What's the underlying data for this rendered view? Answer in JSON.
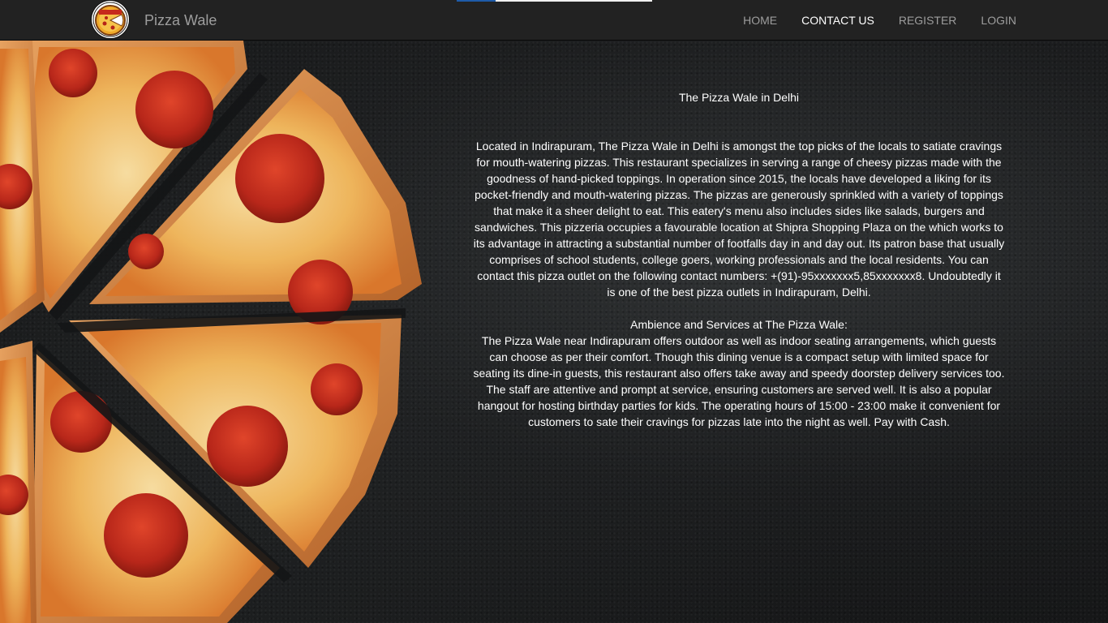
{
  "brand": {
    "name": "Pizza Wale",
    "logo_icon": "pizza-logo-icon"
  },
  "loadbar": {
    "progress": 0.2
  },
  "nav": {
    "items": [
      {
        "label": "HOME",
        "active": false
      },
      {
        "label": "CONTACT US",
        "active": true
      },
      {
        "label": "REGISTER",
        "active": false
      },
      {
        "label": "LOGIN",
        "active": false
      }
    ]
  },
  "content": {
    "heading": "The Pizza Wale in Delhi",
    "intro": "Located in Indirapuram, The Pizza Wale in Delhi is amongst the top picks of the locals to satiate cravings for mouth-watering pizzas. This restaurant specializes in serving a range of cheesy pizzas made with the goodness of hand-picked toppings. In operation since 2015, the locals have developed a liking for its pocket-friendly and mouth-watering pizzas. The pizzas are generously sprinkled with a variety of toppings that make it a sheer delight to eat. This eatery's menu also includes sides like salads, burgers and sandwiches. This pizzeria occupies a favourable location at Shipra Shopping Plaza on the which works to its advantage in attracting a substantial number of footfalls day in and day out. Its patron base that usually comprises of school students, college goers, working professionals and the local residents. You can contact this pizza outlet on the following contact numbers: +(91)-95xxxxxxx5,85xxxxxxx8. Undoubtedly it is one of the best pizza outlets in Indirapuram, Delhi.",
    "ambience_heading": "Ambience and Services at The Pizza Wale:",
    "ambience_text": "The Pizza Wale near Indirapuram offers outdoor as well as indoor seating arrangements, which guests can choose as per their comfort. Though this dining venue is a compact setup with limited space for seating its dine-in guests, this restaurant also offers take away and speedy doorstep delivery services too. The staff are attentive and prompt at service, ensuring customers are served well. It is also a popular hangout for hosting birthday parties for kids. The operating hours of 15:00 - 23:00 make it convenient for customers to sate their cravings for pizzas late into the night as well. Pay with Cash."
  },
  "colors": {
    "navbar_bg": "#222222",
    "nav_text": "#9d9d9d",
    "nav_active": "#ffffff",
    "loadbar_fill": "#1e5ba8"
  }
}
